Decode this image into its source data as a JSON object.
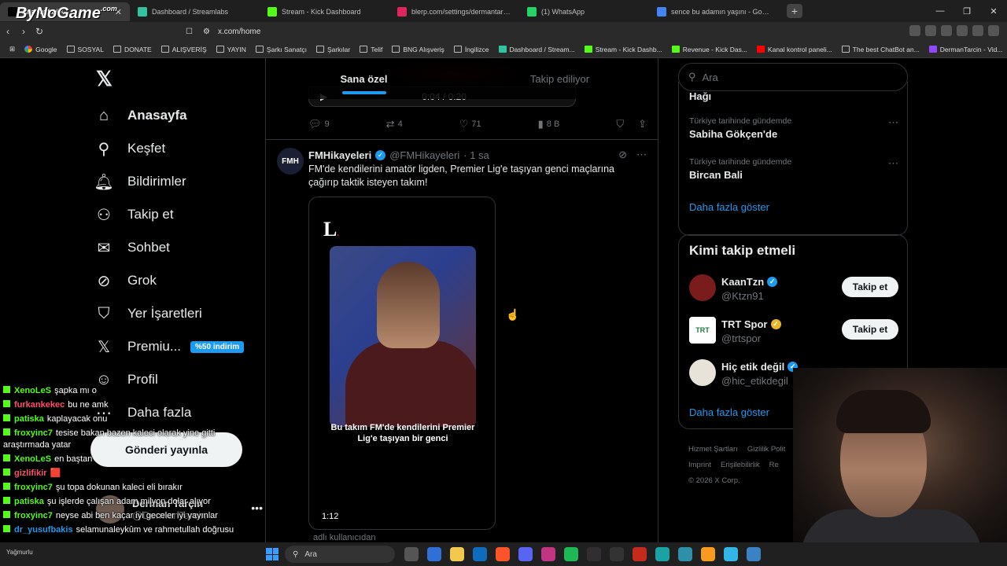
{
  "browser": {
    "tabs": [
      {
        "label": "Ana sayfa / X",
        "color": "#000000",
        "active": true
      },
      {
        "label": "Dashboard / Streamlabs",
        "color": "#31c3a2"
      },
      {
        "label": "Stream - Kick Dashboard",
        "color": "#53fc18"
      },
      {
        "label": "blerp.com/settings/dermantarcin?s=",
        "color": "#e0245e"
      },
      {
        "label": "(1) WhatsApp",
        "color": "#25d366"
      },
      {
        "label": "sence bu adamın yaşını - Google'da",
        "color": "#4285f4"
      }
    ],
    "url": "x.com/home",
    "bookmarks": [
      {
        "label": "Google",
        "icon": "g"
      },
      {
        "label": "SOSYAL",
        "icon": "folder"
      },
      {
        "label": "DONATE",
        "icon": "folder"
      },
      {
        "label": "ALIŞVERİŞ",
        "icon": "folder"
      },
      {
        "label": "YAYIN",
        "icon": "folder"
      },
      {
        "label": "Şarkı Sanatçı",
        "icon": "folder"
      },
      {
        "label": "Şarkılar",
        "icon": "folder"
      },
      {
        "label": "Telif",
        "icon": "folder"
      },
      {
        "label": "BNG Alışveriş",
        "icon": "folder"
      },
      {
        "label": "İngilizce",
        "icon": "folder"
      },
      {
        "label": "Dashboard / Stream...",
        "icon": "s"
      },
      {
        "label": "Stream - Kick Dashb...",
        "icon": "k"
      },
      {
        "label": "Revenue - Kick Das...",
        "icon": "k"
      },
      {
        "label": "Kanal kontrol paneli...",
        "icon": "y"
      },
      {
        "label": "The best ChatBot an...",
        "icon": "folder"
      },
      {
        "label": "DermanTarcin - Vid...",
        "icon": "t"
      }
    ]
  },
  "watermark": {
    "main": "ByNoGame",
    "sup": ".com"
  },
  "sidebar": {
    "items": [
      {
        "label": "Anasayfa",
        "icon": "home-icon",
        "glyph": "⌂"
      },
      {
        "label": "Keşfet",
        "icon": "search-icon",
        "glyph": "⚲"
      },
      {
        "label": "Bildirimler",
        "icon": "bell-icon",
        "glyph": "🔔︎"
      },
      {
        "label": "Takip et",
        "icon": "add-person-icon",
        "glyph": "⚇"
      },
      {
        "label": "Sohbet",
        "icon": "mail-icon",
        "glyph": "✉"
      },
      {
        "label": "Grok",
        "icon": "grok-icon",
        "glyph": "⊘"
      },
      {
        "label": "Yer İşaretleri",
        "icon": "bookmark-icon",
        "glyph": "⛉"
      },
      {
        "label": "Premiu...",
        "icon": "x-premium-icon",
        "glyph": "𝕏"
      },
      {
        "label": "Profil",
        "icon": "profile-icon",
        "glyph": "☺"
      },
      {
        "label": "Daha fazla",
        "icon": "more-icon",
        "glyph": "⋯"
      }
    ],
    "premium_badge": "%50 indirim",
    "post_button": "Gönderi yayınla",
    "account": {
      "name": "Derman Tarçın",
      "handle": "@DermanTarcin",
      "more": "•••"
    }
  },
  "timeline": {
    "tabs": [
      "Sana özel",
      "Takip ediliyor"
    ],
    "prev_player_time": "0:04 / 0:20",
    "prev_actions": {
      "replies": "9",
      "reposts": "4",
      "likes": "71",
      "views": "8 B"
    },
    "tweet": {
      "avatar_text": "FMH",
      "name": "FMHikayeleri",
      "handle": "@FMHikayeleri",
      "time": "· 1 sa",
      "text": "FM'de kendilerini amatör ligden, Premier Lig'e taşıyan genci maçlarına çağırıp taktik isteyen takım!",
      "video": {
        "logo": "L",
        "caption": "Bu takım FM'de kendilerini Premier Lig'e taşıyan bir genci",
        "duration": "1:12"
      }
    },
    "below_text": "adlı kullanıcıdan"
  },
  "right": {
    "search_placeholder": "Ara",
    "trend_top_cut": "Hağı",
    "trends": [
      {
        "context": "Türkiye tarihinde gündemde",
        "name": "Sabiha Gökçen'de"
      },
      {
        "context": "Türkiye tarihinde gündemde",
        "name": "Bircan Bali"
      }
    ],
    "show_more": "Daha fazla göster",
    "who_to_follow": {
      "title": "Kimi takip etmeli",
      "users": [
        {
          "name": "KaanTzn",
          "handle": "@Ktzn91",
          "badge": "blue",
          "color": "#7a1c1c"
        },
        {
          "name": "TRT Spor",
          "handle": "@trtspor",
          "badge": "gold",
          "color": "#ffffff"
        },
        {
          "name": "Hiç etik değil",
          "handle": "@hic_etikdegil",
          "badge": "blue",
          "color": "#e8e3d8"
        }
      ],
      "follow_label": "Takip et",
      "show_more": "Daha fazla göster"
    },
    "footer": [
      "Hizmet Şartları",
      "Gizlilik Polit",
      "Imprint",
      "Erişilebilirlik",
      "Re",
      "© 2026 X Corp."
    ]
  },
  "chat": [
    {
      "user": "XenoLeS",
      "color": "#53fc18",
      "msg": "şapka mı o"
    },
    {
      "user": "furkankekec",
      "color": "#ff4d6d",
      "msg": "bu ne amk"
    },
    {
      "user": "patiska",
      "color": "#53fc18",
      "msg": "kaplayacak onu"
    },
    {
      "user": "froxyinc7",
      "color": "#53fc18",
      "msg": "tesise bakan bazen kaleci olarak yine gitti araştırmada yatar"
    },
    {
      "user": "XenoLeS",
      "color": "#53fc18",
      "msg": "en baştan"
    },
    {
      "user": "gizlifikir",
      "color": "#ff4d6d",
      "msg": "🟥"
    },
    {
      "user": "froxyinc7",
      "color": "#53fc18",
      "msg": "şu topa dokunan kaleci eli bırakır"
    },
    {
      "user": "patiska",
      "color": "#53fc18",
      "msg": "şu işlerde çalışan adam milyon dolar alıyor"
    },
    {
      "user": "froxyinc7",
      "color": "#53fc18",
      "msg": "neyse abi ben kaçar iyi geceler iyi yayınlar"
    },
    {
      "user": "dr_yusufbakis",
      "color": "#1d9bf0",
      "msg": "selamunaleykûm ve rahmetullah doğrusu"
    }
  ],
  "taskbar": {
    "search": "Ara",
    "weather": "Yağmurlu"
  }
}
